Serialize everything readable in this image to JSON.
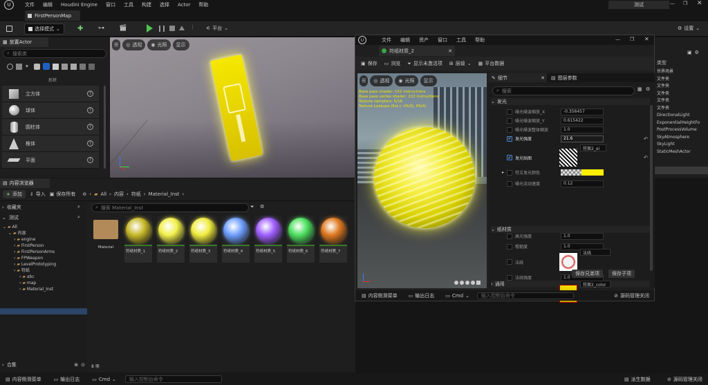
{
  "main_menu": [
    "文件",
    "编辑",
    "Houdini Engine",
    "窗口",
    "工具",
    "构建",
    "选择",
    "Actor",
    "帮助"
  ],
  "window_title": "测试",
  "level_tab": "FirstPersonMap",
  "toolbar": {
    "save": "保存",
    "select_mode": "选择模式",
    "platform": "平台",
    "settings": "设置"
  },
  "place_actor": {
    "tab": "放置Actor",
    "search_placeholder": "搜索类",
    "category_label": "形状",
    "items": [
      {
        "label": "立方体",
        "icon": "cube-icon"
      },
      {
        "label": "球体",
        "icon": "sphere-icon"
      },
      {
        "label": "圆柱体",
        "icon": "cylinder-icon"
      },
      {
        "label": "椎体",
        "icon": "cone-icon"
      },
      {
        "label": "平面",
        "icon": "plane-icon"
      }
    ]
  },
  "viewport": {
    "btn_perspective": "透视",
    "btn_lit": "光照",
    "btn_show": "显示"
  },
  "content_browser": {
    "tab": "内容浏览器",
    "add": "添加",
    "import": "导入",
    "save_all": "保存所有",
    "path": [
      "All",
      "内容",
      "符纸",
      "Material_Inst"
    ],
    "favorites": "收藏夹",
    "collection": "测试",
    "search_placeholder": "搜索 Material_Inst",
    "tree": [
      {
        "label": "All",
        "level": 0
      },
      {
        "label": "内容",
        "level": 1
      },
      {
        "label": "engine",
        "level": 2
      },
      {
        "label": "FirstPerson",
        "level": 2
      },
      {
        "label": "FirstPersonArms",
        "level": 2
      },
      {
        "label": "FPWeapon",
        "level": 2
      },
      {
        "label": "LevelPrototyping",
        "level": 2
      },
      {
        "label": "符纸",
        "level": 2
      },
      {
        "label": "abc",
        "level": 3
      },
      {
        "label": "map",
        "level": 3
      },
      {
        "label": "Material_Inst",
        "level": 3
      }
    ],
    "assets": [
      {
        "label": "Material",
        "kind": "folder"
      },
      {
        "label": "符纸材质_1",
        "color": "#c8b92a",
        "bar": "#3b7a2a"
      },
      {
        "label": "符纸材质_2",
        "color": "#f2f04a",
        "bar": "#3b7a2a"
      },
      {
        "label": "符纸材质_3",
        "color": "#f0ec40",
        "bar": "#3b7a2a"
      },
      {
        "label": "符纸材质_4",
        "color": "#6fa0ff",
        "bar": "#3b7a2a"
      },
      {
        "label": "符纸材质_5",
        "color": "#a060ff",
        "bar": "#3b7a2a"
      },
      {
        "label": "符纸材质_6",
        "color": "#4ee060",
        "bar": "#3b7a2a"
      },
      {
        "label": "符纸材质_7",
        "color": "#e07a22",
        "bar": "#3b7a2a"
      }
    ],
    "item_count": "8 项",
    "collections": "合集"
  },
  "bottom": {
    "drawer": "内容侧滑菜单",
    "log": "输出日志",
    "cmd": "Cmd",
    "cmd_placeholder": "输入控制台命令",
    "derived": "派生数据",
    "source_control": "源码管理关闭"
  },
  "outliner": {
    "header": "类型",
    "types": [
      "世界场景",
      "文件夹",
      "文件夹",
      "文件夹",
      "文件夹",
      "文件夹",
      "DirectionalLight",
      "ExponentialHeightFo",
      "PostProcessVolume",
      "SkyAtmosphere",
      "SkyLight",
      "StaticMeshActor"
    ]
  },
  "material_editor": {
    "menu": [
      "文件",
      "编辑",
      "资产",
      "窗口",
      "工具",
      "帮助"
    ],
    "tab": "符纸材质_2",
    "toolbar": {
      "save": "保存",
      "browse": "浏览",
      "hierarchy": "层级",
      "platform_stats": "平台数据",
      "show_inactive": "显示未激活项"
    },
    "viewport": {
      "btn_perspective": "透视",
      "btn_lit": "光照",
      "btn_show": "显示"
    },
    "stats": [
      "Base pass shader: 152 instructions",
      "Base pass vertex shader: 222 instructions",
      "Texture samplers: 5/16",
      "Texture Lookups (Est.): VS(0), PS(4)"
    ],
    "details_tab": "细节",
    "layer_tab": "图层参数",
    "search_placeholder": "搜索",
    "section_glow": "发光",
    "params_glow": [
      {
        "label": "噪光噪波缩放_X",
        "value": "-0.356457",
        "on": false
      },
      {
        "label": "噪光噪波缩放_Y",
        "value": "0.615422",
        "on": false
      },
      {
        "label": "噪光噪波整体缩放",
        "value": "1.0",
        "on": false
      },
      {
        "label": "发光强度",
        "value": "21.6",
        "on": true
      },
      {
        "label": "发光贴图",
        "value": "符案2_ei",
        "on": true
      },
      {
        "label": "符文发光颜色",
        "value": "",
        "on": false
      },
      {
        "label": "噪光流动速度",
        "value": "0.12",
        "on": false
      }
    ],
    "section_paper": "纸材质",
    "params_paper": [
      {
        "label": "高光强度",
        "value": "1.0"
      },
      {
        "label": "粗糙度",
        "value": "1.0"
      },
      {
        "label": "法线",
        "value": "法线"
      },
      {
        "label": "法线强度",
        "value": "1.0"
      },
      {
        "label": "基础色",
        "value": "符案2_color",
        "on": true
      }
    ],
    "save_sibling": "保存兄弟项",
    "save_child": "保存子项",
    "section_general": "通用",
    "bottom": {
      "drawer": "内容侧滑菜单",
      "log": "输出日志",
      "cmd": "Cmd",
      "cmd_placeholder": "输入控制台命令",
      "source_control": "源码管理关闭"
    },
    "glow_color": "#ffee00"
  }
}
